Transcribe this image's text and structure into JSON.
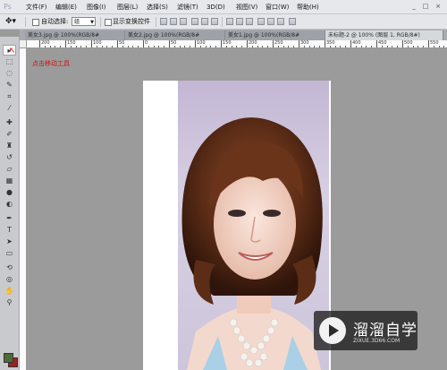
{
  "menubar": {
    "logo": "Ps",
    "items": [
      "文件(F)",
      "编辑(E)",
      "图像(I)",
      "图层(L)",
      "选择(S)",
      "滤镜(T)",
      "3D(D)",
      "视图(V)",
      "窗口(W)",
      "帮助(H)"
    ],
    "window_buttons": [
      "_",
      "□",
      "×"
    ]
  },
  "options": {
    "auto_select_label": "自动选择:",
    "auto_select_value": "组",
    "show_transform_label": "显示变换控件"
  },
  "tabs": [
    "美女3.jpg @ 100%(RGB/8#",
    "美女2.jpg @ 100%(RGB/8#",
    "美女1.jpg @ 100%(RGB/8#",
    "未标题-2 @ 100% (图层 1, RGB/8#)"
  ],
  "ruler": {
    "h_labels": [
      "200",
      "150",
      "100",
      "50",
      "0",
      "50",
      "100",
      "150",
      "200",
      "250",
      "300",
      "350",
      "400",
      "450",
      "500",
      "550"
    ]
  },
  "annotation": "点击移动工具",
  "watermark": {
    "title": "溜溜自学",
    "url": "ZIXUE.3D66.COM"
  },
  "colors": {
    "foreground": "#4e6b3b",
    "background": "#a01e1e",
    "annotation": "#d01010"
  }
}
